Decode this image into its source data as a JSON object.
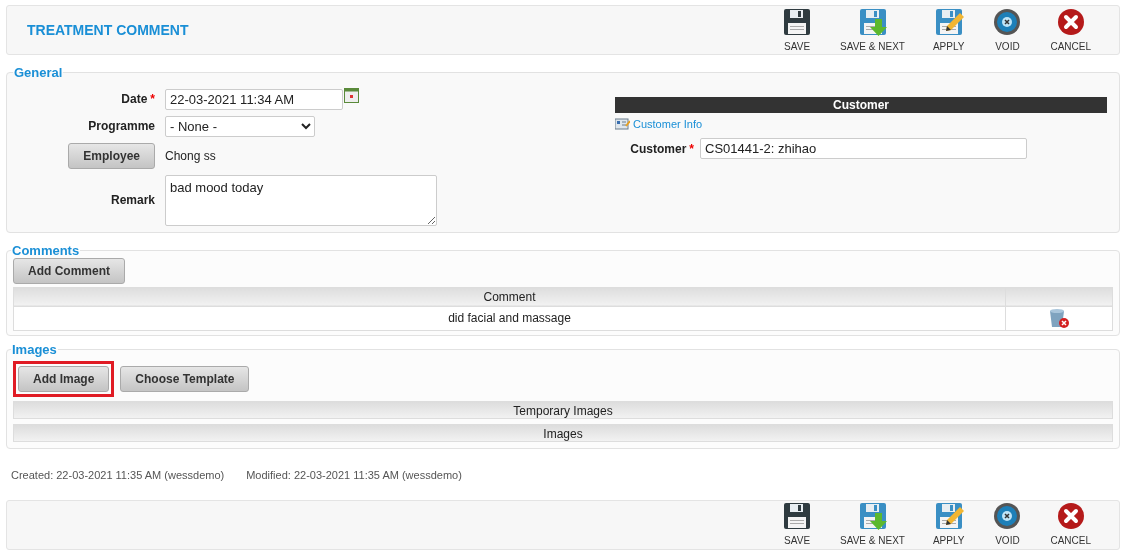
{
  "title": "TREATMENT COMMENT",
  "toolbar": [
    {
      "kind": "save",
      "label": "SAVE"
    },
    {
      "kind": "save_next",
      "label": "SAVE & NEXT"
    },
    {
      "kind": "apply",
      "label": "APPLY"
    },
    {
      "kind": "void",
      "label": "VOID"
    },
    {
      "kind": "cancel",
      "label": "CANCEL"
    }
  ],
  "general": {
    "legend": "General",
    "date": {
      "label": "Date",
      "required_mark": "*",
      "value": "22-03-2021 11:34 AM"
    },
    "programme": {
      "label": "Programme",
      "value": "- None -"
    },
    "employee": {
      "button": "Employee",
      "value": "Chong ss"
    },
    "remark": {
      "label": "Remark",
      "value": "bad mood today"
    },
    "customer_header": "Customer",
    "customer_info_link": "Customer Info",
    "customer": {
      "label": "Customer",
      "required_mark": "*",
      "value": "CS01441-2: zhihao"
    }
  },
  "comments": {
    "legend": "Comments",
    "add_button": "Add Comment",
    "columns": [
      "Comment"
    ],
    "rows": [
      {
        "comment": "did facial and massage"
      }
    ]
  },
  "images": {
    "legend": "Images",
    "buttons": [
      {
        "label": "Add Image",
        "highlighted": true
      },
      {
        "label": "Choose Template",
        "highlighted": false
      }
    ],
    "sections": [
      "Temporary Images",
      "Images"
    ]
  },
  "meta": {
    "created": "Created: 22-03-2021 11:35 AM (wessdemo)",
    "modified": "Modified: 22-03-2021 11:35 AM (wessdemo)"
  },
  "bottom_toolbar": [
    {
      "kind": "save",
      "label": "SAVE"
    },
    {
      "kind": "save_next",
      "label": "SAVE & NEXT"
    },
    {
      "kind": "apply",
      "label": "APPLY"
    },
    {
      "kind": "void",
      "label": "VOID"
    },
    {
      "kind": "cancel",
      "label": "CANCEL"
    }
  ]
}
